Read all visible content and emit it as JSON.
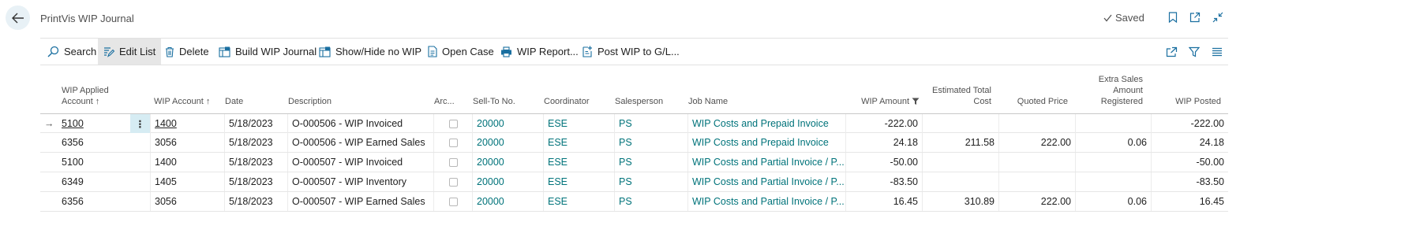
{
  "page": {
    "title": "PrintVis WIP Journal",
    "saved_label": "Saved"
  },
  "actions": [
    {
      "label": "Search",
      "icon": "search-icon"
    },
    {
      "label": "Edit List",
      "icon": "edit-list-icon",
      "active": true
    },
    {
      "label": "Delete",
      "icon": "trash-icon"
    },
    {
      "label": "Build WIP Journal",
      "icon": "build-journal-icon"
    },
    {
      "label": "Show/Hide no WIP",
      "icon": "show-hide-icon"
    },
    {
      "label": "Open Case",
      "icon": "document-icon"
    },
    {
      "label": "WIP Report...",
      "icon": "printer-icon"
    },
    {
      "label": "Post WIP to G/L...",
      "icon": "post-icon"
    }
  ],
  "columns": [
    {
      "label1": "WIP Applied",
      "label2": "Account ↑"
    },
    {
      "label1": "",
      "label2": "WIP Account ↑"
    },
    {
      "label1": "",
      "label2": "Date"
    },
    {
      "label1": "",
      "label2": "Description"
    },
    {
      "label1": "",
      "label2": "Arc..."
    },
    {
      "label1": "",
      "label2": "Sell-To No."
    },
    {
      "label1": "",
      "label2": "Coordinator"
    },
    {
      "label1": "",
      "label2": "Salesperson"
    },
    {
      "label1": "",
      "label2": "Job Name"
    },
    {
      "label1": "",
      "label2": "WIP Amount"
    },
    {
      "label1": "Estimated Total",
      "label2": "Cost"
    },
    {
      "label1": "",
      "label2": "Quoted Price"
    },
    {
      "label0": "Extra Sales",
      "label1": "Amount",
      "label2": "Registered"
    },
    {
      "label1": "",
      "label2": "WIP Posted"
    }
  ],
  "rows": [
    {
      "applied": "5100",
      "wip_account": "1400",
      "date": "5/18/2023",
      "description": "O-000506 - WIP Invoiced",
      "sell_to": "20000",
      "coordinator": "ESE",
      "salesperson": "PS",
      "job_name": "WIP Costs and Prepaid Invoice",
      "wip_amount": "-222.00",
      "est_cost": "",
      "quoted": "",
      "extra": "",
      "posted": "-222.00"
    },
    {
      "applied": "6356",
      "wip_account": "3056",
      "date": "5/18/2023",
      "description": "O-000506 - WIP Earned Sales",
      "sell_to": "20000",
      "coordinator": "ESE",
      "salesperson": "PS",
      "job_name": "WIP Costs and Prepaid Invoice",
      "wip_amount": "24.18",
      "est_cost": "211.58",
      "quoted": "222.00",
      "extra": "0.06",
      "posted": "24.18"
    },
    {
      "applied": "5100",
      "wip_account": "1400",
      "date": "5/18/2023",
      "description": "O-000507 - WIP Invoiced",
      "sell_to": "20000",
      "coordinator": "ESE",
      "salesperson": "PS",
      "job_name": "WIP Costs and Partial Invoice / P...",
      "wip_amount": "-50.00",
      "est_cost": "",
      "quoted": "",
      "extra": "",
      "posted": "-50.00"
    },
    {
      "applied": "6349",
      "wip_account": "1405",
      "date": "5/18/2023",
      "description": "O-000507 - WIP Inventory",
      "sell_to": "20000",
      "coordinator": "ESE",
      "salesperson": "PS",
      "job_name": "WIP Costs and Partial Invoice / P...",
      "wip_amount": "-83.50",
      "est_cost": "",
      "quoted": "",
      "extra": "",
      "posted": "-83.50"
    },
    {
      "applied": "6356",
      "wip_account": "3056",
      "date": "5/18/2023",
      "description": "O-000507 - WIP Earned Sales",
      "sell_to": "20000",
      "coordinator": "ESE",
      "salesperson": "PS",
      "job_name": "WIP Costs and Partial Invoice / P...",
      "wip_amount": "16.45",
      "est_cost": "310.89",
      "quoted": "222.00",
      "extra": "0.06",
      "posted": "16.45"
    }
  ],
  "colors": {
    "accent": "#00737a",
    "back_bg": "#e8f1f6",
    "active_bg": "#e6e6e6"
  }
}
